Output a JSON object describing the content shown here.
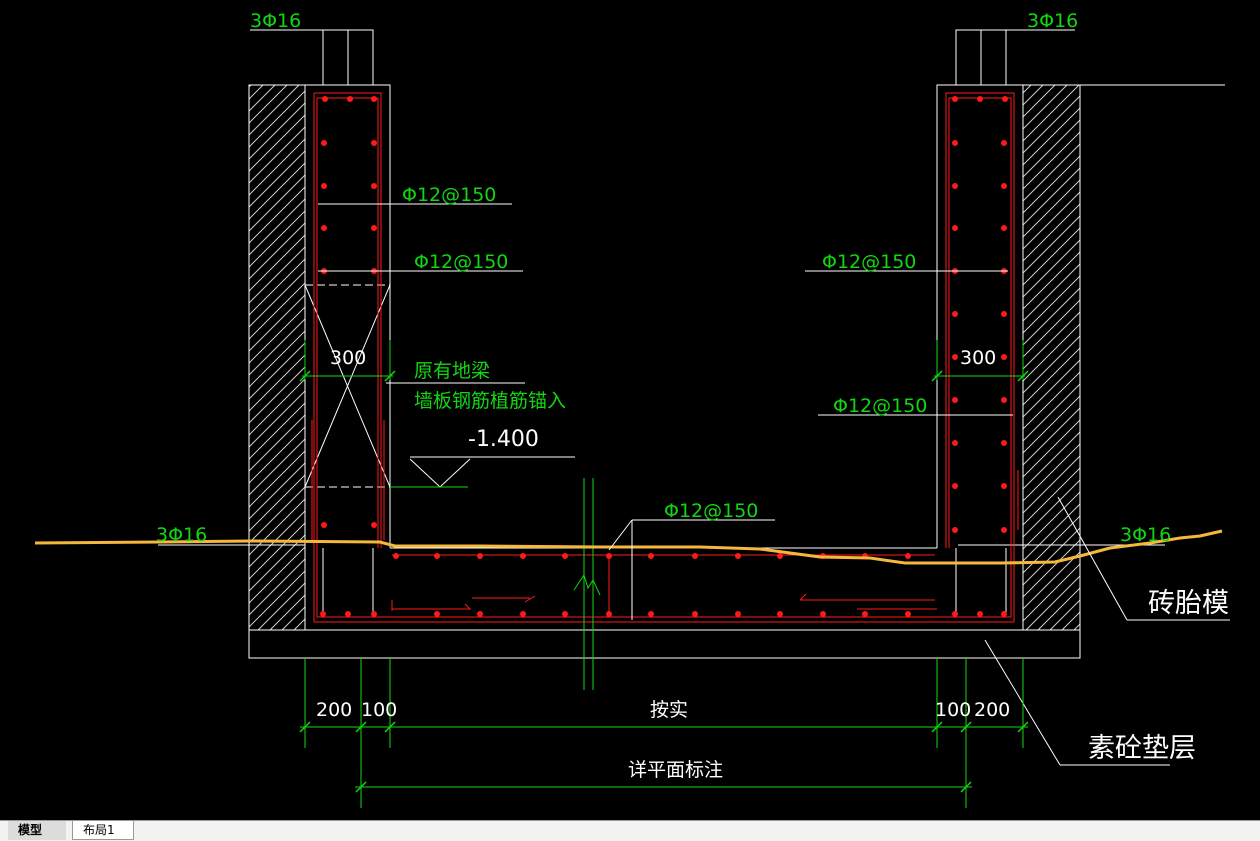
{
  "labels": {
    "top_left_rebar": "3Φ16",
    "top_right_rebar": "3Φ16",
    "left_wall_rebar_1": "Φ12@150",
    "left_wall_rebar_2": "Φ12@150",
    "right_wall_rebar_1": "Φ12@150",
    "right_wall_rebar_2": "Φ12@150",
    "slab_rebar": "Φ12@150",
    "left_slab_rebar": "3Φ16",
    "right_slab_rebar": "3Φ16",
    "left_wall_width": "300",
    "right_wall_width": "300",
    "note_line1": "原有地梁",
    "note_line2": "墙板钢筋植筋锚入",
    "elevation": "-1.400",
    "brick_formwork": "砖胎模",
    "plain_concrete_cushion": "素砼垫层"
  },
  "dimensions": {
    "left_200": "200",
    "left_100": "100",
    "middle": "按实",
    "right_100": "100",
    "right_200": "200",
    "overall": "详平面标注"
  },
  "tabs": {
    "model": "模型",
    "layout1": "布局1"
  },
  "colors": {
    "background": "#000000",
    "text": "#12d612",
    "rebar": "#ff1a1a",
    "outline": "#ffffff",
    "soil_line": "#f5b83d"
  }
}
